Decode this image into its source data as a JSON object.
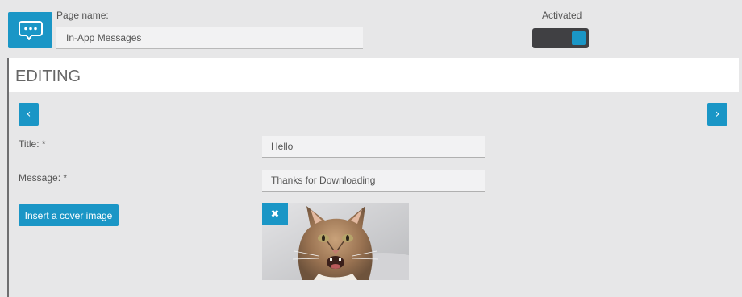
{
  "header": {
    "page_icon": "chat-bubble-icon",
    "page_name_label": "Page name:",
    "page_name_value": "In-App Messages",
    "activated_label": "Activated",
    "activated": true
  },
  "editing": {
    "title": "EDITING",
    "prev_glyph": "‹",
    "next_glyph": "›",
    "title_label": "Title: *",
    "title_value": "Hello",
    "message_label": "Message: *",
    "message_value": "Thanks for Downloading",
    "cover_button_label": "Insert a cover image",
    "remove_glyph": "✖",
    "cover_image": "cat-photo"
  },
  "colors": {
    "accent": "#1a96c6",
    "background": "#e7e7e8",
    "toggle_track": "#404043"
  }
}
